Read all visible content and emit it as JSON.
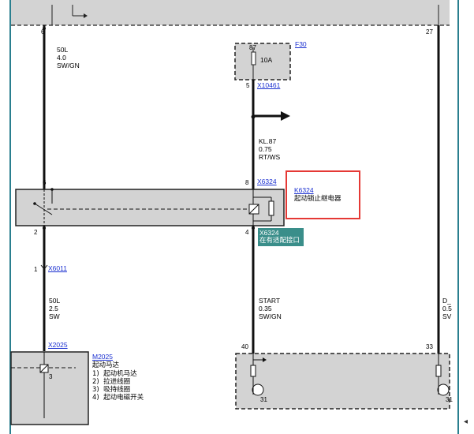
{
  "components": {
    "fuse": {
      "id": "F30",
      "rating": "10A",
      "pin_top": "87"
    },
    "relay": {
      "id": "K6324",
      "name": "起动锁止继电器"
    },
    "starter": {
      "id": "M2025",
      "name": "起动马达",
      "parts": [
        "1)  起动机马达",
        "2)  拉进线圈",
        "3)  吸持线圈",
        "4)  起动电磁开关"
      ],
      "pin": "3"
    }
  },
  "connectors": {
    "x10461": {
      "id": "X10461",
      "pin": "5"
    },
    "x6324_top": {
      "id": "X6324",
      "pin": "8"
    },
    "x6324_bottom": {
      "id": "X6324",
      "note": "在有适配接口",
      "pin": "4"
    },
    "x6011": {
      "id": "X6011",
      "pin": "1"
    },
    "x2025": {
      "id": "X2025"
    }
  },
  "wires": {
    "left_upper": {
      "code": "50L",
      "size": "4.0",
      "color": "SW/GN"
    },
    "right_upper": {
      "code": "KL.87",
      "size": "0.75",
      "color": "RT/WS"
    },
    "left_lower": {
      "code": "50L",
      "size": "2.5",
      "color": "SW"
    },
    "right_lower": {
      "code": "START",
      "size": "0.35",
      "color": "SW/GN"
    },
    "far_right": {
      "code": "D_",
      "size": "0.5",
      "color": "SV"
    }
  },
  "pins": {
    "top_left": "6",
    "top_right": "27",
    "relay_left": "6",
    "relay_bottom_left": "2",
    "bottom_center": "40",
    "bottom_right": "33",
    "ground_left": "31",
    "ground_right": "31"
  },
  "ui": {
    "scroll_arrow": "◂"
  }
}
